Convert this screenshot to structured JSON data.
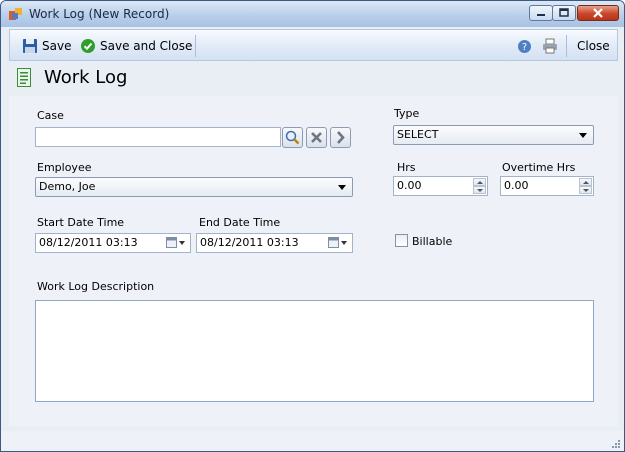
{
  "window": {
    "title": "Work Log (New Record)"
  },
  "toolbar": {
    "save_label": "Save",
    "save_close_label": "Save and Close",
    "close_label": "Close"
  },
  "header": {
    "title": "Work Log"
  },
  "form": {
    "case": {
      "label": "Case",
      "value": ""
    },
    "type": {
      "label": "Type",
      "value": "SELECT"
    },
    "employee": {
      "label": "Employee",
      "value": "Demo, Joe"
    },
    "hrs": {
      "label": "Hrs",
      "value": "0.00"
    },
    "overtime": {
      "label": "Overtime Hrs",
      "value": "0.00"
    },
    "start": {
      "label": "Start Date Time",
      "value": "08/12/2011 03:13"
    },
    "end": {
      "label": "End Date Time",
      "value": "08/12/2011 03:13"
    },
    "billable": {
      "label": "Billable",
      "checked": false
    },
    "description": {
      "label": "Work Log Description",
      "value": ""
    }
  },
  "icons": {
    "app": "app-window-icon",
    "save": "floppy-disk-icon",
    "save_close": "green-check-icon",
    "help": "help-icon",
    "print": "printer-icon",
    "header": "document-icon",
    "lookup": "magnifier-icon",
    "clear": "x-icon",
    "goto": "arrow-right-icon",
    "calendar": "calendar-icon"
  },
  "colors": {
    "accent": "#d3e1f3",
    "save_close_check": "#2f9e2f",
    "close_button": "#c8462a"
  }
}
